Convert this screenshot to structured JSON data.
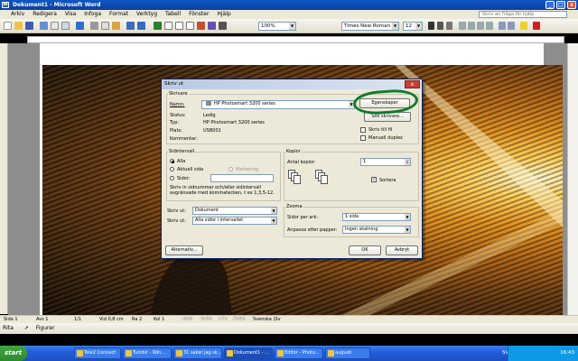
{
  "window": {
    "title": "Dokument1 - Microsoft Word",
    "minimize": "_",
    "maximize": "□",
    "close": "x"
  },
  "menu": {
    "items": [
      "Arkiv",
      "Redigera",
      "Visa",
      "Infoga",
      "Format",
      "Verktyg",
      "Tabell",
      "Fönster",
      "Hjälp"
    ],
    "help_placeholder": "Skriv en fråga för hjälp"
  },
  "toolbar": {
    "zoom": "100%",
    "font": "Times New Roman",
    "size": "12"
  },
  "dialog": {
    "title": "Skriv ut",
    "close": "x",
    "printer_group": "Skrivare",
    "name_label": "Namn:",
    "name_value": "HP Photosmart 3200 series",
    "status_label": "Status:",
    "status_value": "Ledig",
    "type_label": "Typ:",
    "type_value": "HP Photosmart 3200 series",
    "place_label": "Plats:",
    "place_value": "USB001",
    "comment_label": "Kommentar:",
    "properties_button": "Egenskaper",
    "find_printer_button": "Sök skrivare...",
    "print_to_file": "Skriv till fil",
    "manual_duplex": "Manuell duplex",
    "page_range_group": "Sidintervall",
    "all": "Alla",
    "current_page": "Aktuell sida",
    "selection": "Markering",
    "pages": "Sidor:",
    "pages_hint": "Skriv in sidnummer och/eller sidintervall avgränsade med kommatecken, t ex 1,3,5-12.",
    "copies_group": "Kopior",
    "copies_label": "Antal kopior:",
    "copies_value": "1",
    "collate": "Sortera",
    "print_what_label": "Skriv ut:",
    "print_what_value": "Dokument",
    "print_label": "Skriv ut:",
    "print_value": "Alla sidor i intervallet",
    "zoom_group": "Zooma",
    "pages_per_sheet_label": "Sidor per ark:",
    "pages_per_sheet_value": "1 sida",
    "scale_label": "Anpassa efter papper:",
    "scale_value": "Ingen skalning",
    "options_button": "Alternativ...",
    "ok_button": "OK",
    "cancel_button": "Avbryt"
  },
  "statusbar": {
    "page": "Sida 1",
    "section": "Avs 1",
    "of": "1/1",
    "at": "Vid 0,8 cm",
    "line": "Ra 2",
    "col": "Kol 1",
    "rec": "INSP",
    "trk": "SPÅR",
    "ext": "UTV",
    "ovr": "ÖVER",
    "lang": "Svenska (Sv"
  },
  "drawbar": {
    "draw": "Rita",
    "shapes": "Figurer"
  },
  "taskbar": {
    "start": "start",
    "tasks": [
      "Tele2 Connect",
      "Tumblr - Win...",
      "31 saker jag sk...",
      "Dokument1 - ...",
      "Editor - Photo...",
      "augusti"
    ],
    "lang": "SV",
    "clock": "16:43"
  },
  "colors": {
    "accent": "#137a2d",
    "title": "#0a3f9f"
  }
}
